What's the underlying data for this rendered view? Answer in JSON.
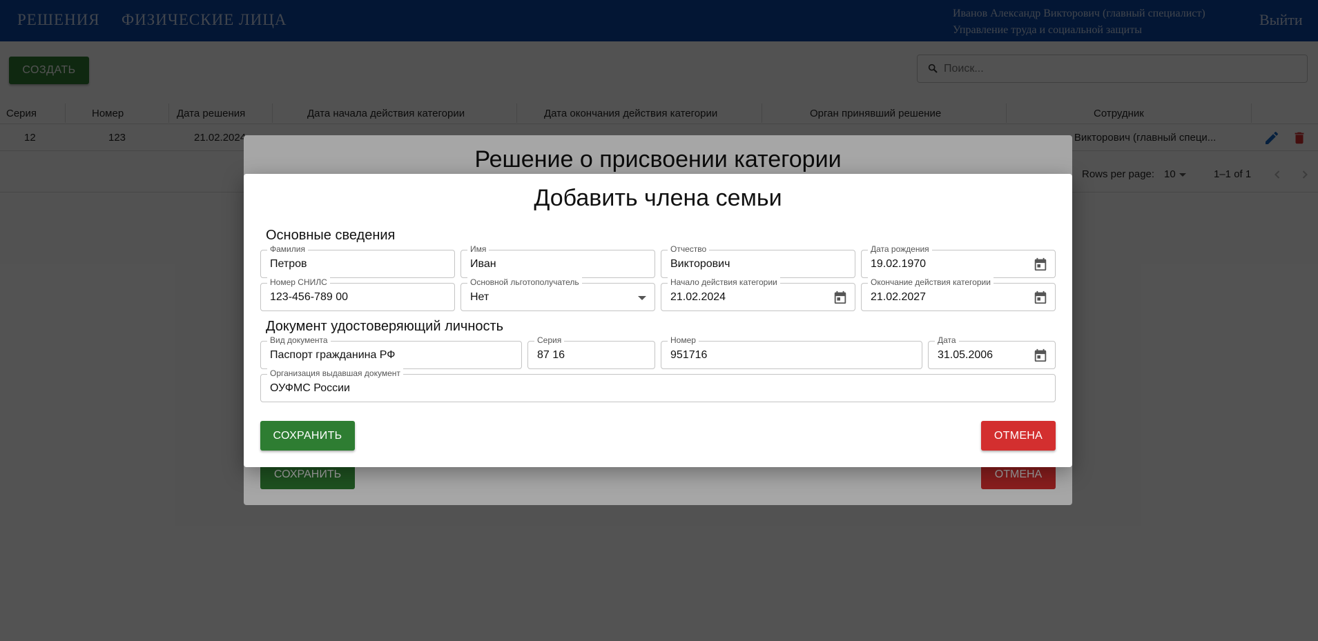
{
  "header": {
    "nav": [
      "РЕШЕНИЯ",
      "ФИЗИЧЕСКИЕ ЛИЦА"
    ],
    "user_name": "Иванов Александр Викторович (главный специалист)",
    "user_org": "Управление труда и социальной защиты",
    "logout": "Выйти"
  },
  "toolbar": {
    "create_label": "СОЗДАТЬ",
    "search_placeholder": "Поиск..."
  },
  "table": {
    "columns": [
      "Серия",
      "Номер",
      "Дата решения",
      "Дата начала действия категории",
      "Дата окончания действия категории",
      "Орган принявший решение",
      "Сотрудник"
    ],
    "row": [
      "12",
      "123",
      "21.02.2024",
      "андр Викторович (главный специ..."
    ],
    "rows_per_page_label": "Rows per page:",
    "rows_per_page": "10",
    "range": "1–1 of 1"
  },
  "back_dialog": {
    "title": "Решение о присвоении категории",
    "save_label": "СОХРАНИТЬ",
    "cancel_label": "ОТМЕНА"
  },
  "dialog": {
    "title": "Добавить члена семьи",
    "section_main": "Основные сведения",
    "section_doc": "Документ удостоверяющий личность",
    "fields": {
      "last_name": {
        "label": "Фамилия",
        "value": "Петров"
      },
      "first_name": {
        "label": "Имя",
        "value": "Иван"
      },
      "patronymic": {
        "label": "Отчество",
        "value": "Викторович"
      },
      "birth_date": {
        "label": "Дата рождения",
        "value": "19.02.1970"
      },
      "snils": {
        "label": "Номер СНИЛС",
        "value": "123-456-789 00"
      },
      "main_beneficiary": {
        "label": "Основной льготополучатель",
        "value": "Нет"
      },
      "category_start": {
        "label": "Начало действия категории",
        "value": "21.02.2024"
      },
      "category_end": {
        "label": "Окончание действия категории",
        "value": "21.02.2027"
      },
      "doc_type": {
        "label": "Вид документа",
        "value": "Паспорт гражданина РФ"
      },
      "doc_series": {
        "label": "Серия",
        "value": "87 16"
      },
      "doc_number": {
        "label": "Номер",
        "value": "951716"
      },
      "doc_date": {
        "label": "Дата",
        "value": "31.05.2006"
      },
      "doc_org": {
        "label": "Организация выдавшая документ",
        "value": "ОУФМС России"
      }
    },
    "save_label": "СОХРАНИТЬ",
    "cancel_label": "ОТМЕНА"
  },
  "colors": {
    "header": "#0d47a1",
    "save": "#2e7d32",
    "cancel": "#d32f2f",
    "edit_icon": "#1565c0",
    "delete_icon": "#d32f2f"
  },
  "icons": [
    "search-icon",
    "edit-icon",
    "delete-icon",
    "calendar-icon",
    "dropdown-caret-icon",
    "chevron-left-icon",
    "chevron-right-icon"
  ]
}
